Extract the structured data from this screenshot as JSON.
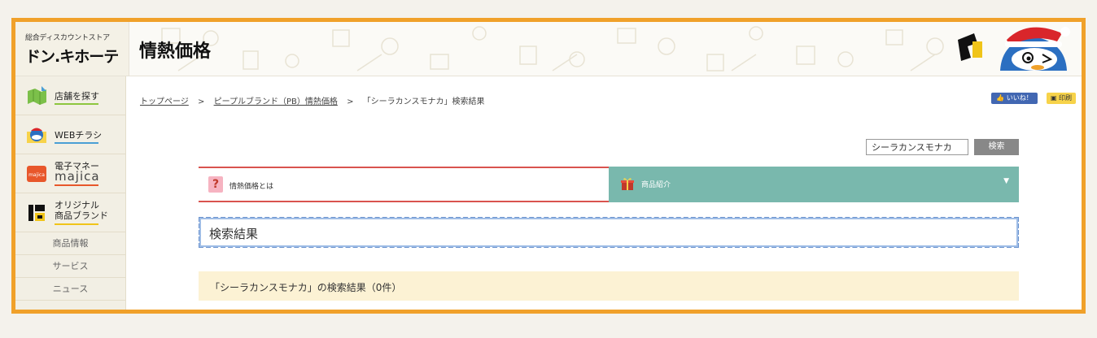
{
  "store": {
    "tagline": "総合ディスカウントストア",
    "logo": "ドン.キホーテ"
  },
  "header": {
    "title": "情熱価格"
  },
  "sidebar": {
    "items": [
      {
        "label": "店舗を探す",
        "icon": "store-map-icon",
        "underline": "#8dc63f"
      },
      {
        "label": "WEBチラシ",
        "icon": "mascot-flyer-icon",
        "underline": "#4a9fd5"
      },
      {
        "label": "電子マネー",
        "label2": "majica",
        "icon": "majica-card-icon",
        "underline": "#e8572b"
      },
      {
        "label": "オリジナル",
        "label2": "商品ブランド",
        "icon": "pb-logo-icon",
        "underline": "#f0c419"
      }
    ],
    "links": [
      "商品情報",
      "サービス",
      "ニュース"
    ]
  },
  "breadcrumb": {
    "home": "トップページ",
    "brand": "ピープルブランド（PB）情熱価格",
    "current": "「シーラカンスモナカ」検索結果",
    "sep": ">"
  },
  "social": {
    "like": "👍 いいね！",
    "print": "印刷"
  },
  "search": {
    "value": "シーラカンスモナカ",
    "button": "検索"
  },
  "tabs": {
    "about": "情熱価格とは",
    "products": "商品紹介",
    "caret": "▼"
  },
  "results": {
    "heading": "検索結果",
    "message": "「シーラカンスモナカ」の検索結果（0件）"
  },
  "colors": {
    "frame": "#f0a12a",
    "tab_products": "#79b8ad",
    "tab_about_border": "#d9534f",
    "result_border": "#6b93cf",
    "notice_bg": "#fcf2d4"
  }
}
